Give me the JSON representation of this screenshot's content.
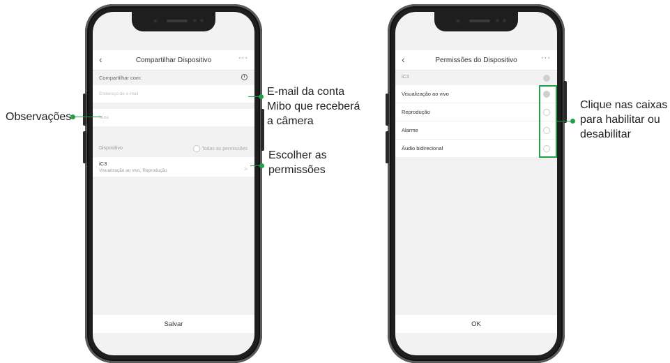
{
  "left_screen": {
    "title": "Compartilhar Dispositivo",
    "share_with_label": "Compartilhar com:",
    "email_placeholder": "Endereço de e-mail",
    "note_placeholder": "Nota",
    "device_label": "Dispositivo",
    "all_permissions_label": "Todas as permissões",
    "device_name": "iC3",
    "device_permissions": "Visualização ao vivo, Reprodução",
    "save_label": "Salvar"
  },
  "right_screen": {
    "title": "Permissões do Dispositivo",
    "device_name": "iC3",
    "permissions": [
      {
        "label": "Visualização ao vivo",
        "checked": true
      },
      {
        "label": "Reprodução",
        "checked": false
      },
      {
        "label": "Alarme",
        "checked": false
      },
      {
        "label": "Áudio bidirecional",
        "checked": false
      }
    ],
    "ok_label": "OK"
  },
  "callouts": {
    "observacoes": "Observações",
    "email_line1": "E-mail da conta",
    "email_line2": "Mibo que receberá",
    "email_line3": "a câmera",
    "perm_line1": "Escolher as",
    "perm_line2": "permissões",
    "click_line1": "Clique nas caixas",
    "click_line2": "para habilitar ou",
    "click_line3": "desabilitar"
  },
  "colors": {
    "accent_green": "#1fa14a"
  }
}
